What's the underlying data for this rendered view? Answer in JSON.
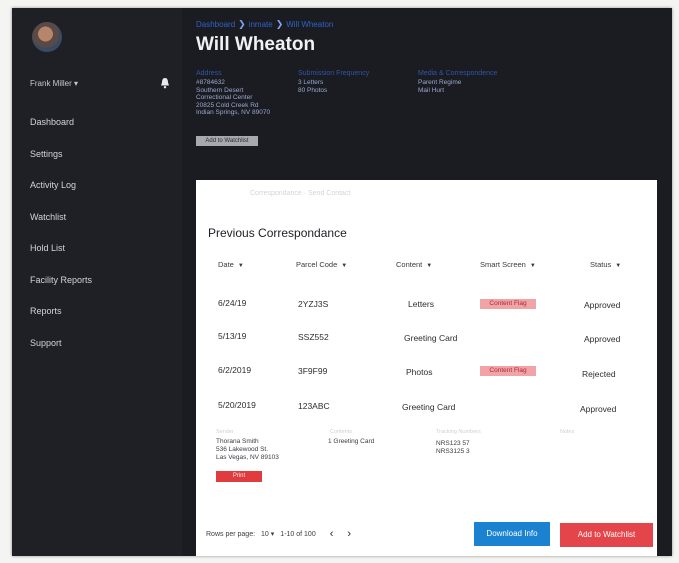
{
  "sidebar": {
    "user_name": "Frank Miller",
    "user_caret": "▾",
    "items": [
      {
        "label": "Dashboard"
      },
      {
        "label": "Settings"
      },
      {
        "label": "Activity Log"
      },
      {
        "label": "Watchlist"
      },
      {
        "label": "Hold List"
      },
      {
        "label": "Facility Reports"
      },
      {
        "label": "Reports"
      },
      {
        "label": "Support"
      }
    ]
  },
  "header": {
    "breadcrumb": [
      "Dashboard",
      "inmate",
      "Will Wheaton"
    ],
    "title": "Will Wheaton"
  },
  "info": {
    "address_label": "Address",
    "address_lines": [
      "#8784632",
      "Southern Desert",
      "Correctional Center",
      "20825 Cold Creek Rd",
      "Indian Springs, NV 89070"
    ],
    "frequency_label": "Submission Frequency",
    "frequency_lines": [
      "3 Letters",
      "80 Photos"
    ],
    "media_label": "Media & Correspondence",
    "media_lines": [
      "Parent Regime",
      "Mail Hurt"
    ],
    "watchlist_small_label": "Add to Watchlist"
  },
  "panel": {
    "subtitle": "Correspondance  ·  Send Contact",
    "title": "Previous Correspondance",
    "columns": [
      "Date",
      "Parcel Code",
      "Content",
      "Smart Screen",
      "Status"
    ],
    "rows": [
      {
        "date": "6/24/19",
        "code": "2YZJ3S",
        "content": "Letters",
        "flag": "Content Flag",
        "status": "Approved"
      },
      {
        "date": "5/13/19",
        "code": "SSZ552",
        "content": "Greeting Card",
        "flag": "",
        "status": "Approved"
      },
      {
        "date": "6/2/2019",
        "code": "3F9F99",
        "content": "Photos",
        "flag": "Content Flag",
        "status": "Rejected"
      },
      {
        "date": "5/20/2019",
        "code": "123ABC",
        "content": "Greeting Card",
        "flag": "",
        "status": "Approved"
      }
    ],
    "detail": {
      "sender_label": "Sender",
      "sender_lines": [
        "Thorana Smith",
        "536 Lakewood St.",
        "Las Vegas, NV 89103"
      ],
      "contents_label": "Contents",
      "contents_value": "1 Greeting Card",
      "tracking_label": "Tracking Numbers",
      "tracking_lines": [
        "NRS123 57",
        "NRS3125 3"
      ],
      "notes_label": "Notes",
      "print_label": "Print"
    },
    "footer": {
      "rows_label": "Rows per page:",
      "rows_value": "10",
      "range": "1-10 of 100",
      "prev": "‹",
      "next": "›"
    },
    "download_label": "Download Info",
    "watchlist_label": "Add to Watchlist"
  }
}
